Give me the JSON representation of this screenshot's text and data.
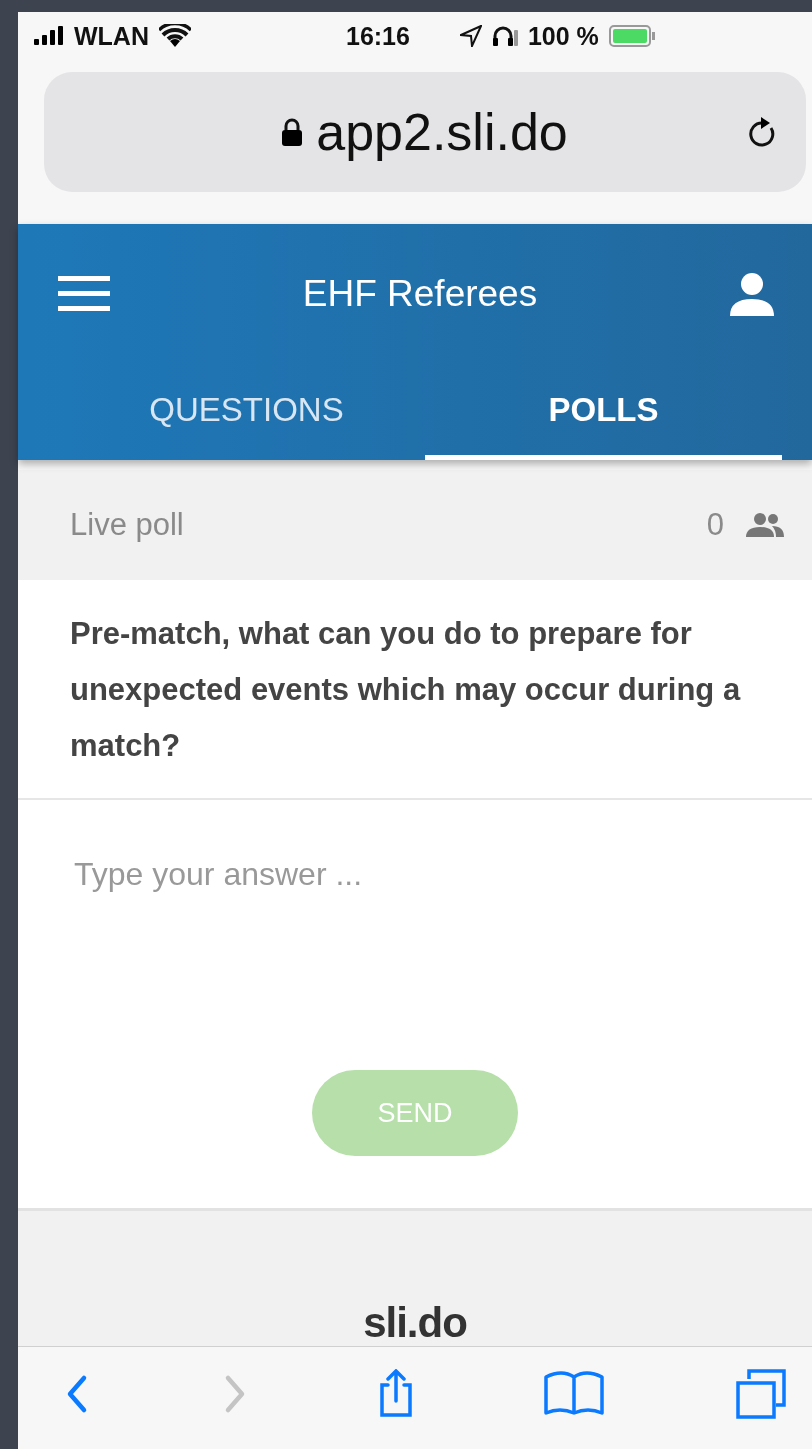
{
  "status_bar": {
    "carrier": "WLAN",
    "time": "16:16",
    "battery": "100 %"
  },
  "address_bar": {
    "url": "app2.sli.do"
  },
  "header": {
    "title": "EHF Referees"
  },
  "tabs": [
    {
      "label": "QUESTIONS",
      "selected": false
    },
    {
      "label": "POLLS",
      "selected": true
    }
  ],
  "poll": {
    "label": "Live poll",
    "participants": "0",
    "question": "Pre-match, what can you do to prepare for unexpected events which may occur during a match?",
    "answer": {
      "placeholder": "Type your answer ..."
    },
    "send": {
      "label": "SEND",
      "disabled": true
    }
  },
  "footer": {
    "logo": "sli.do"
  },
  "toolbar": [
    {
      "kind": "back",
      "disabled": false
    },
    {
      "kind": "forward",
      "disabled": true
    },
    {
      "kind": "share",
      "disabled": false
    },
    {
      "kind": "bookmarks",
      "disabled": false
    },
    {
      "kind": "tabs",
      "disabled": false
    }
  ]
}
